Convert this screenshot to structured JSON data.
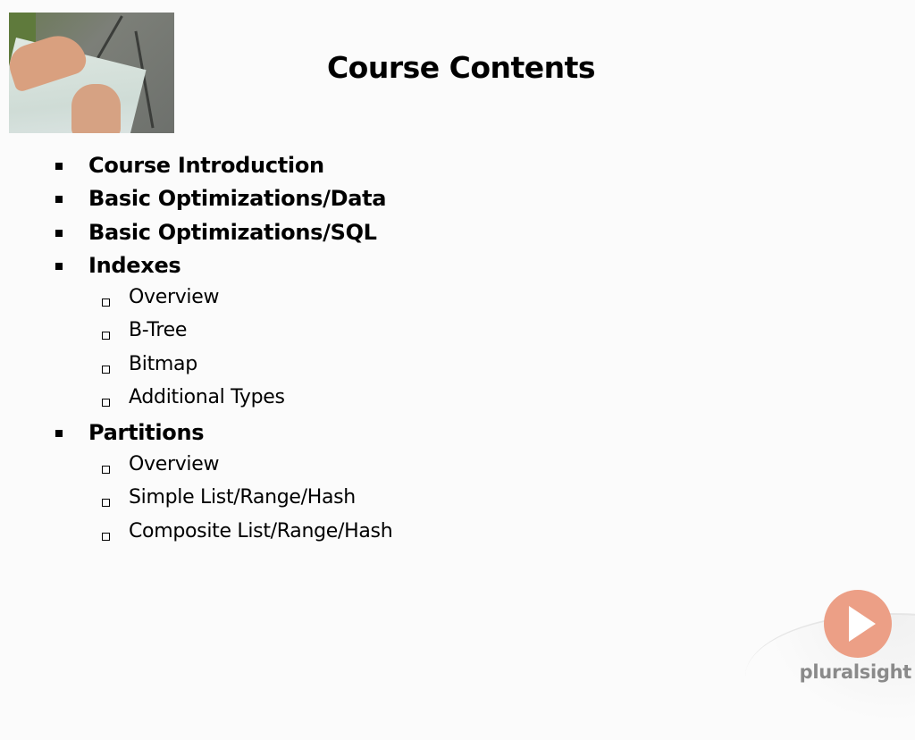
{
  "slide": {
    "title": "Course Contents",
    "image_alt": "hands-on-map-photo"
  },
  "outline": [
    {
      "label": "Course Introduction",
      "level": 1
    },
    {
      "label": "Basic Optimizations/Data",
      "level": 1
    },
    {
      "label": "Basic Optimizations/SQL",
      "level": 1
    },
    {
      "label": "Indexes",
      "level": 1
    },
    {
      "label": "Overview",
      "level": 2
    },
    {
      "label": "B-Tree",
      "level": 2
    },
    {
      "label": "Bitmap",
      "level": 2
    },
    {
      "label": "Additional Types",
      "level": 2
    },
    {
      "label": "Partitions",
      "level": 1
    },
    {
      "label": "Overview",
      "level": 2
    },
    {
      "label": "Simple List/Range/Hash",
      "level": 2
    },
    {
      "label": "Composite List/Range/Hash",
      "level": 2
    }
  ],
  "branding": {
    "name": "pluralsight",
    "logo_icon": "play-icon",
    "accent_color": "#ec9f86"
  }
}
